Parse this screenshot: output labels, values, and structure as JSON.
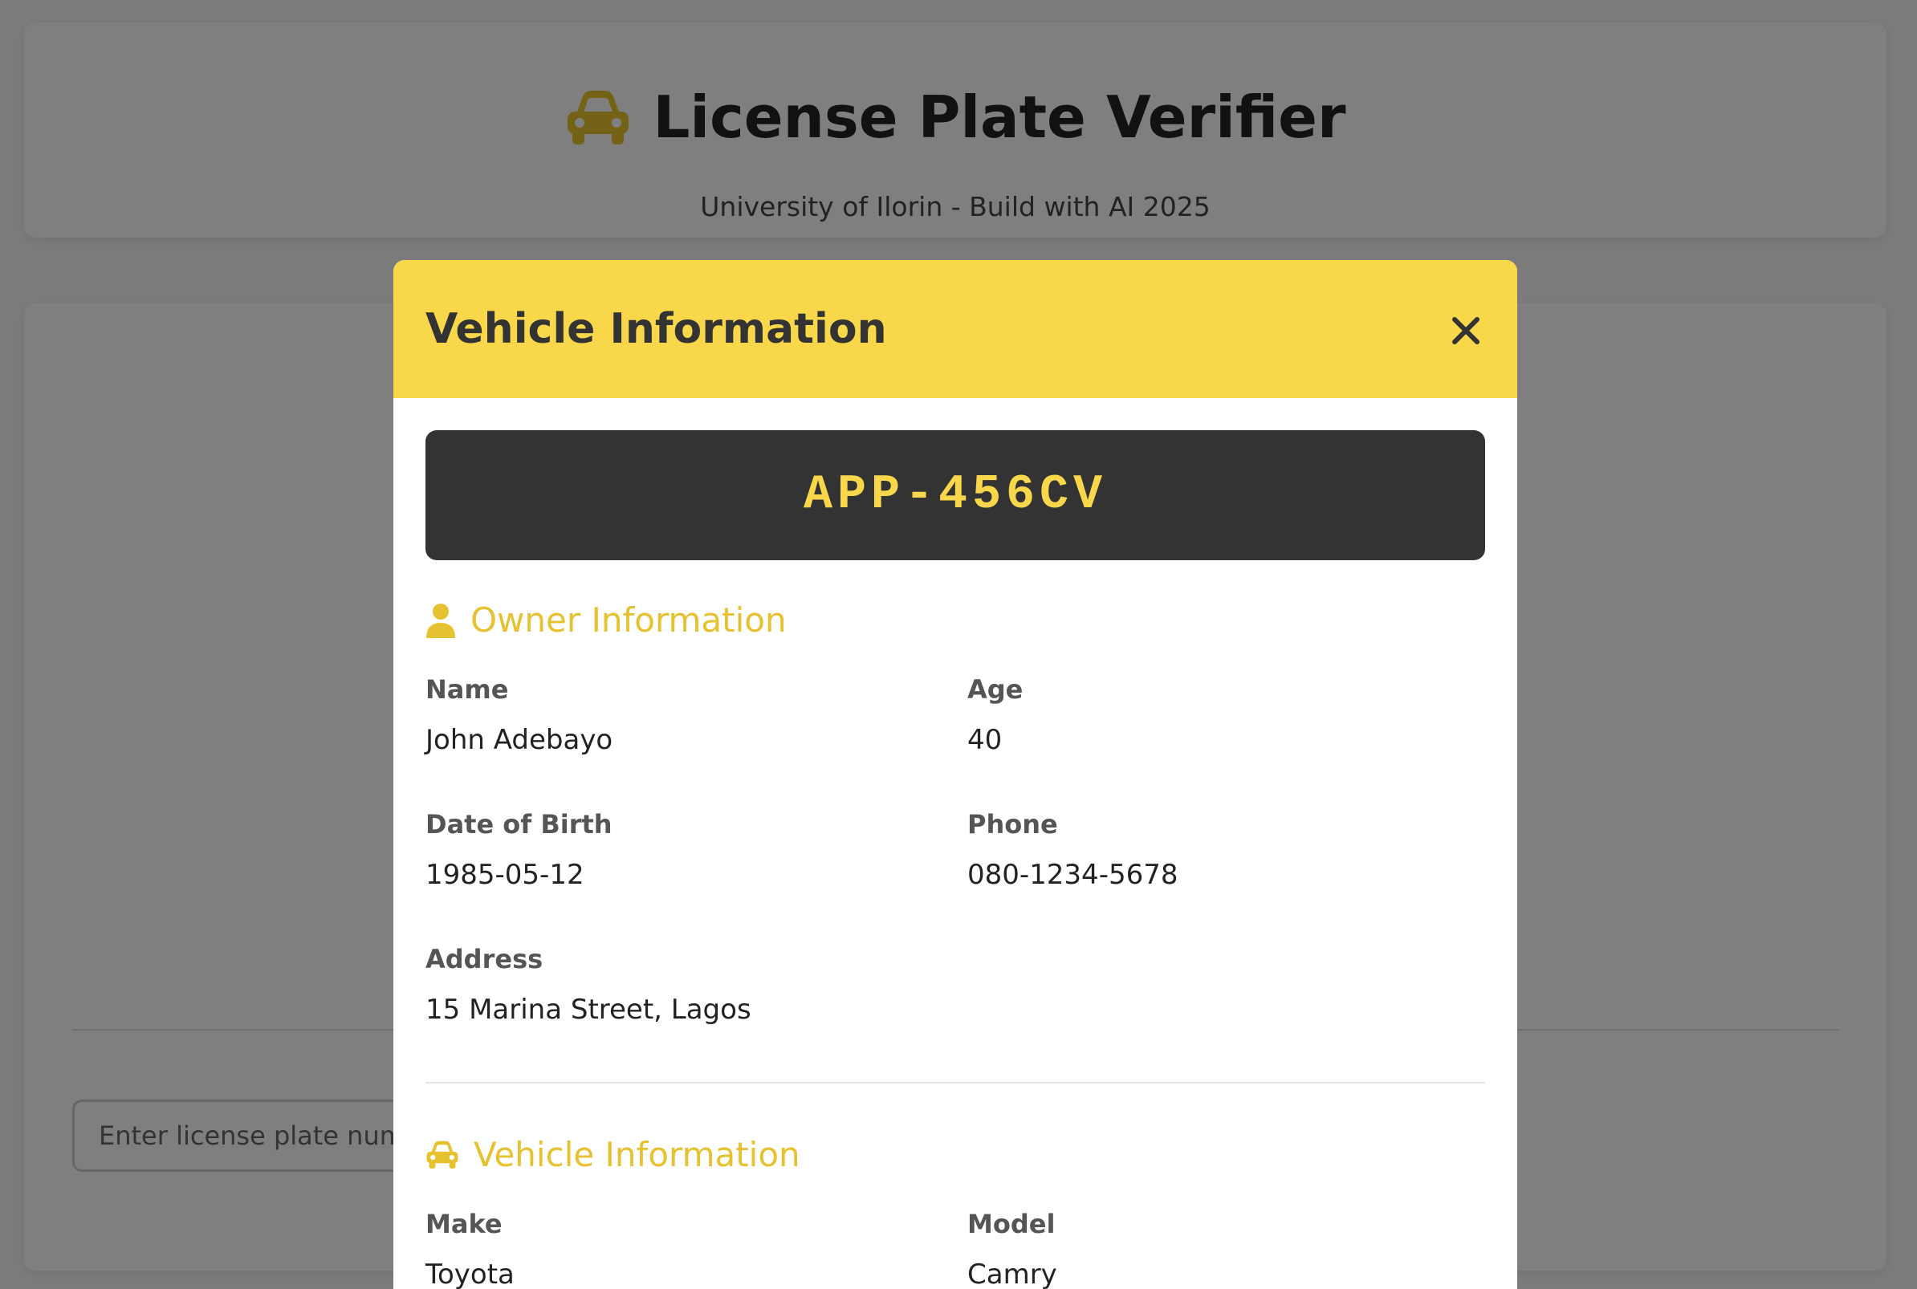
{
  "header": {
    "title": "License Plate Verifier",
    "subtitle": "University of Ilorin - Build with AI 2025",
    "icon": "car-icon"
  },
  "search": {
    "placeholder": "Enter license plate number"
  },
  "modal": {
    "title": "Vehicle Information",
    "close_icon": "close-icon",
    "plate_number": "APP-456CV",
    "owner_section": {
      "title": "Owner Information",
      "icon": "user-icon",
      "fields": {
        "name": {
          "label": "Name",
          "value": "John Adebayo"
        },
        "age": {
          "label": "Age",
          "value": "40"
        },
        "dob": {
          "label": "Date of Birth",
          "value": "1985-05-12"
        },
        "phone": {
          "label": "Phone",
          "value": "080-1234-5678"
        },
        "address": {
          "label": "Address",
          "value": "15 Marina Street, Lagos"
        }
      }
    },
    "vehicle_section": {
      "title": "Vehicle Information",
      "icon": "car-icon",
      "fields": {
        "make": {
          "label": "Make",
          "value": "Toyota"
        },
        "model": {
          "label": "Model",
          "value": "Camry"
        }
      }
    }
  },
  "colors": {
    "accent": "#f9d74a",
    "section_heading": "#e7c230",
    "plate_background": "#333333",
    "overlay": "rgba(0,0,0,0.5)"
  }
}
